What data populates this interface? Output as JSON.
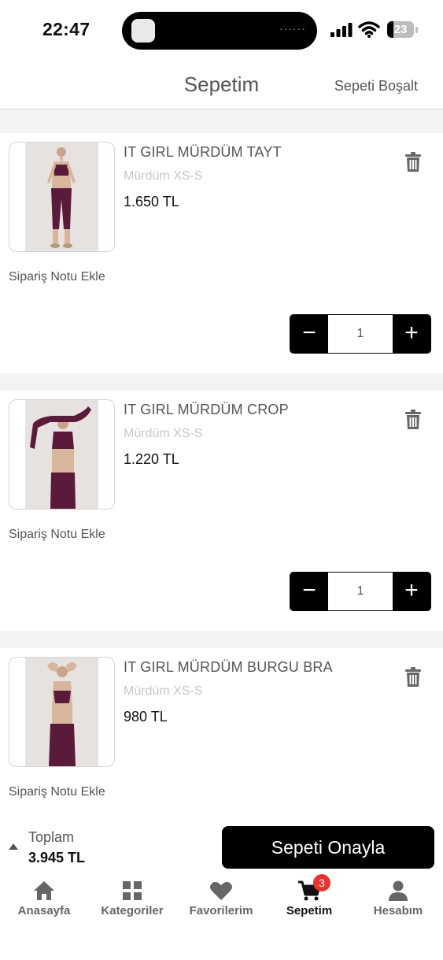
{
  "status_bar": {
    "time": "22:47",
    "battery": "23"
  },
  "header": {
    "title": "Sepetim",
    "clear_label": "Sepeti Boşalt"
  },
  "items": [
    {
      "name": "IT GIRL MÜRDÜM TAYT",
      "variant": "Mürdüm XS-S",
      "price": "1.650 TL",
      "note_label": "Sipariş Notu Ekle",
      "quantity": "1"
    },
    {
      "name": "IT GIRL MÜRDÜM CROP",
      "variant": "Mürdüm XS-S",
      "price": "1.220 TL",
      "note_label": "Sipariş Notu Ekle",
      "quantity": "1"
    },
    {
      "name": "IT GIRL MÜRDÜM BURGU BRA",
      "variant": "Mürdüm XS-S",
      "price": "980 TL",
      "note_label": "Sipariş Notu Ekle"
    }
  ],
  "checkout": {
    "total_label": "Toplam",
    "total_value": "3.945 TL",
    "confirm_label": "Sepeti Onayla"
  },
  "tabs": [
    {
      "label": "Anasayfa",
      "icon": "home-icon"
    },
    {
      "label": "Kategoriler",
      "icon": "grid-icon"
    },
    {
      "label": "Favorilerim",
      "icon": "heart-icon"
    },
    {
      "label": "Sepetim",
      "icon": "cart-icon",
      "badge": "3",
      "active": true
    },
    {
      "label": "Hesabım",
      "icon": "user-icon"
    }
  ],
  "colors": {
    "accent": "#000000",
    "badge": "#e8332f",
    "product": "#5a1a3a"
  }
}
